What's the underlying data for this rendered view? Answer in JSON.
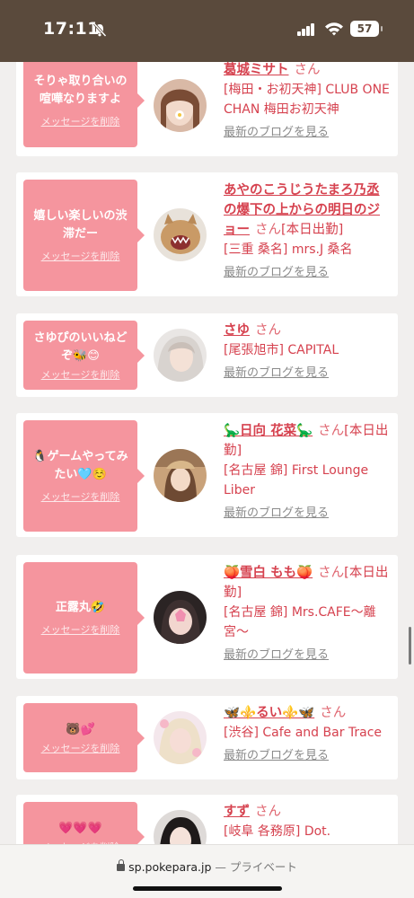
{
  "status_bar": {
    "time": "17:11",
    "battery": "57"
  },
  "common": {
    "delete_label": "メッセージを削除",
    "blog_label": "最新のブログを見る",
    "san": "さん"
  },
  "cards": [
    {
      "message": "そりゃ取り合いの喧嘩なりますよ",
      "name": "葛城ミサト",
      "after_name": "",
      "shop": "[梅田・お初天神] CLUB ONE CHAN 梅田お初天神"
    },
    {
      "message": "嬉しい楽しいの渋滞だー",
      "name": "あやのこうじうたまろ乃丞の爆下の上からの明日のジョー",
      "after_name": "[本日出勤]",
      "shop": "[三重 桑名] mrs.J 桑名"
    },
    {
      "message": "さゆぴのいいねど ぞ🐝😊",
      "name": "さゆ",
      "after_name": "",
      "shop": "[尾張旭市] CAPITAL"
    },
    {
      "message": "🐧ゲームやってみたい🩵☺️",
      "name": "🦕日向 花菜🦕",
      "after_name": "[本日出勤]",
      "shop": "[名古屋 錦] First Lounge Liber"
    },
    {
      "message": "正露丸🤣",
      "name": "🍑雪白 もも🍑",
      "after_name": "[本日出勤]",
      "shop": "[名古屋 錦] Mrs.CAFE〜離宮〜"
    },
    {
      "message": "🐻💕",
      "name": "🦋⚜️るい⚜️🦋",
      "after_name": "",
      "shop": "[渋谷] Cafe and Bar Trace"
    },
    {
      "message": "💗💗💗",
      "name": "すず",
      "after_name": "",
      "shop": "[岐阜 各務原] Dot."
    }
  ],
  "browser": {
    "domain": "sp.pokepara.jp",
    "private_label": "— プライベート"
  }
}
